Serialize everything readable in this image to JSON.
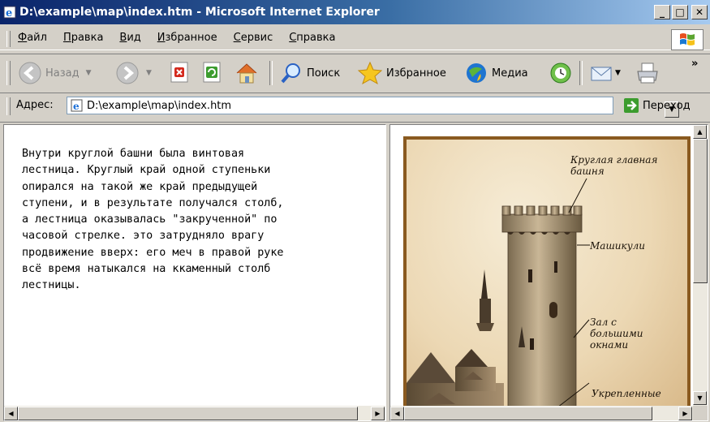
{
  "window": {
    "title": "D:\\example\\map\\index.htm - Microsoft Internet Explorer"
  },
  "menu": [
    "Файл",
    "Правка",
    "Вид",
    "Избранное",
    "Сервис",
    "Справка"
  ],
  "toolbar": {
    "back": "Назад",
    "search": "Поиск",
    "favorites": "Избранное",
    "media": "Медиа",
    "more": "»"
  },
  "address": {
    "label": "Адрес:",
    "value": "D:\\example\\map\\index.htm",
    "go": "Переход"
  },
  "content": {
    "text": "Внутри круглой башни была винтовая\nлестница. Круглый край одной ступеньки\nопирался на такой же край предыдущей\nступени, и в результате получался столб,\nа лестница оказывалась \"закрученной\" по\nчасовой стрелке. это затрудняло врагу\nпродвижение вверх: его меч в правой руке\nвсё время натыкался на ккаменный столб\nлестницы."
  },
  "illustration": {
    "labels": [
      "Круглая главная башня",
      "Машикули",
      "Зал с большими окнами",
      "Укрепленные"
    ]
  }
}
